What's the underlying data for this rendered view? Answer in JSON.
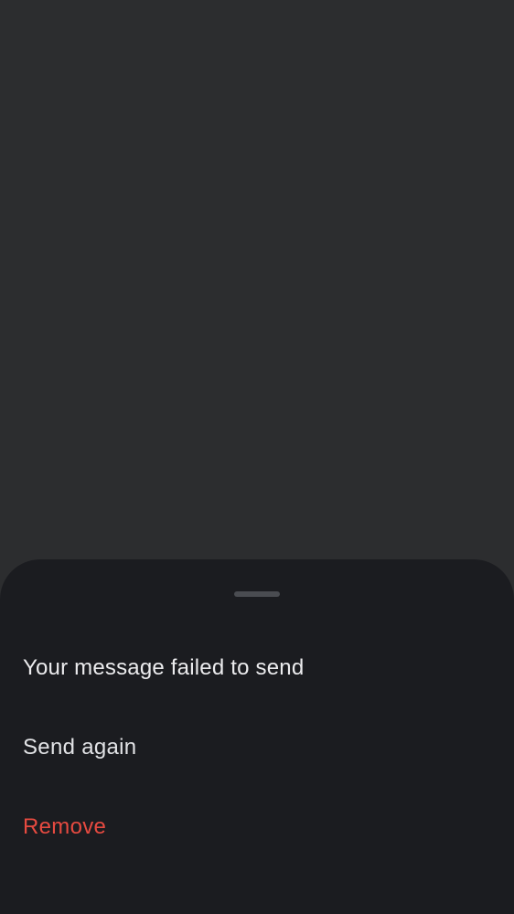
{
  "sheet": {
    "title": "Your message failed to send",
    "actions": [
      {
        "label": "Send again",
        "color": "#e2e3e6"
      },
      {
        "label": "Remove",
        "color": "#e64a40"
      }
    ]
  },
  "colors": {
    "background": "#2c2d2f",
    "sheet": "#1b1c20",
    "handle": "#4a4c51",
    "text": "#ececee",
    "destructive": "#e64a40"
  }
}
